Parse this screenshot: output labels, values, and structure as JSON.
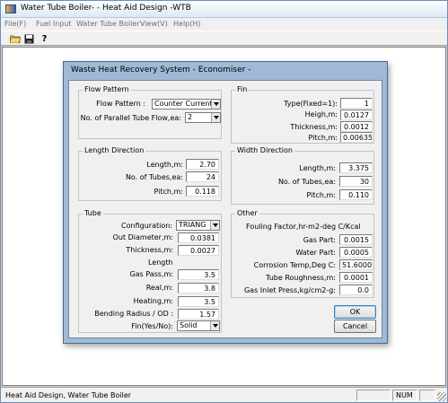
{
  "window": {
    "title": "Water Tube Boiler- - Heat Aid Design -WTB"
  },
  "menu": [
    "File(F)",
    "Fuel Input",
    "Water Tube Boiler",
    "View(V)",
    "Help(H)"
  ],
  "toolbar": {
    "icons": [
      "open-folder-icon",
      "save-disk-icon",
      "help-question-icon"
    ],
    "help_glyph": "?"
  },
  "statusbar": {
    "text": "Heat Aid Design, Water Tube Boiler",
    "num": "NUM"
  },
  "dialog": {
    "title": "Waste Heat Recovery System - Economiser -",
    "flow": {
      "title": "Flow Pattern",
      "pattern_label": "Flow Pattern :",
      "pattern_value": "Counter Current",
      "parallel_label": "No. of Parallel Tube Flow,ea:",
      "parallel_value": "2"
    },
    "fin": {
      "title": "Fin",
      "type_label": "Type(Fixed=1):",
      "type_value": "1",
      "height_label": "Heigh,m:",
      "height_value": "0.0127",
      "thickness_label": "Thickness,m:",
      "thickness_value": "0.0012",
      "pitch_label": "Pitch,m:",
      "pitch_value": "0.00635"
    },
    "length_dir": {
      "title": "Length Direction",
      "length_label": "Length,m:",
      "length_value": "2.70",
      "tubes_label": "No. of Tubes,ea:",
      "tubes_value": "24",
      "pitch_label": "Pitch,m:",
      "pitch_value": "0.118"
    },
    "width_dir": {
      "title": "Width Direction",
      "length_label": "Length,m:",
      "length_value": "3.375",
      "tubes_label": "No. of Tubes,ea:",
      "tubes_value": "30",
      "pitch_label": "Pitch,m:",
      "pitch_value": "0.110"
    },
    "tube": {
      "title": "Tube",
      "config_label": "Configuration:",
      "config_value": "TRIANG",
      "od_label": "Out Diameter,m:",
      "od_value": "0.0381",
      "thickness_label": "Thickness,m:",
      "thickness_value": "0.0027",
      "length_heading": "Length",
      "gas_pass_label": "Gas Pass,m:",
      "gas_pass_value": "3.5",
      "real_label": "Real,m:",
      "real_value": "3.8",
      "heating_label": "Heating,m:",
      "heating_value": "3.5",
      "bending_label": "Bending Radius / OD :",
      "bending_value": "1.57",
      "fin_label": "Fin(Yes/No):",
      "fin_value": "Solid"
    },
    "other": {
      "title": "Other",
      "fouling_label": "Fouling Factor,hr-m2-deg C/Kcal",
      "gas_part_label": "Gas Part:",
      "gas_part_value": "0.0015",
      "water_part_label": "Water Part:",
      "water_part_value": "0.0005",
      "corrosion_label": "Corrosion Temp,Deg C:",
      "corrosion_value": "51.6000",
      "roughness_label": "Tube Roughness,m:",
      "roughness_value": "0.0001",
      "inlet_label": "Gas Inlet Press,kg/cm2-g:",
      "inlet_value": "0.0"
    },
    "ok_label": "OK",
    "cancel_label": "Cancel"
  }
}
